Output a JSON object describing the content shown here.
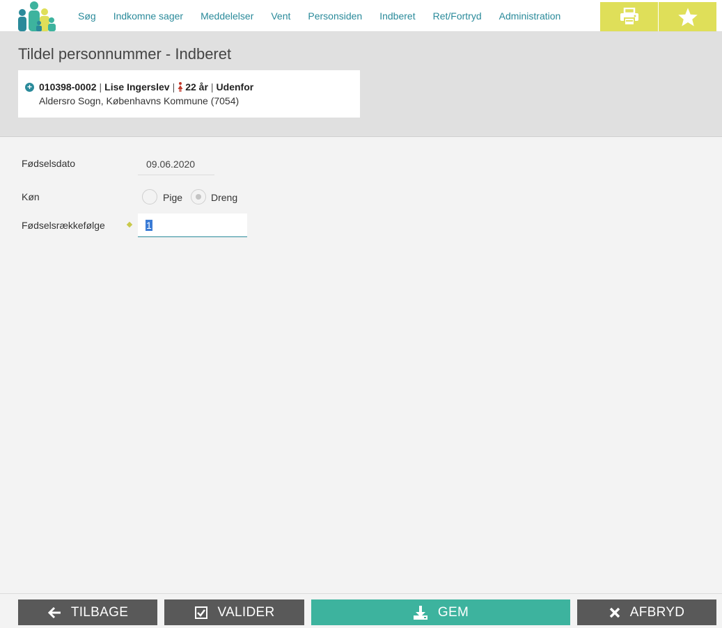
{
  "nav": {
    "items": [
      {
        "label": "Søg"
      },
      {
        "label": "Indkomne sager"
      },
      {
        "label": "Meddelelser"
      },
      {
        "label": "Vent"
      },
      {
        "label": "Personsiden"
      },
      {
        "label": "Indberet"
      },
      {
        "label": "Ret/Fortryd"
      },
      {
        "label": "Administration"
      }
    ],
    "icons": {
      "print": "printer-icon",
      "favorite": "star-icon"
    }
  },
  "page": {
    "title": "Tildel personnummer - Indberet"
  },
  "person": {
    "cpr": "010398-0002",
    "name": "Lise Ingerslev",
    "age": "22 år",
    "status": "Udenfor",
    "location": "Aldersro Sogn, Københavns Kommune (7054)"
  },
  "form": {
    "dob_label": "Fødselsdato",
    "dob_value": "09.06.2020",
    "gender_label": "Køn",
    "gender_options": [
      "Pige",
      "Dreng"
    ],
    "gender_selected": "Dreng",
    "birth_order_label": "Fødselsrækkefølge",
    "birth_order_value": "1"
  },
  "footer": {
    "back": "TILBAGE",
    "validate": "VALIDER",
    "save": "GEM",
    "cancel": "AFBRYD"
  },
  "colors": {
    "accent": "#2a8a9a",
    "highlight": "#dfdf59",
    "save": "#3db39e",
    "button": "#595959",
    "female": "#c0392b"
  }
}
